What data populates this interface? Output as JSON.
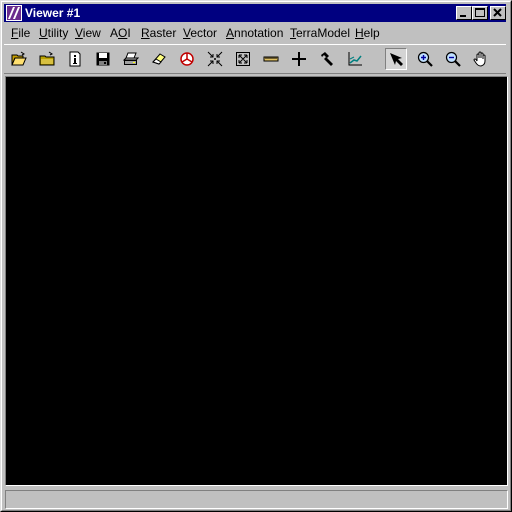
{
  "window": {
    "title": "Viewer #1"
  },
  "titlebar_buttons": [
    {
      "name": "minimize-button",
      "icon": "minimize-icon"
    },
    {
      "name": "maximize-button",
      "icon": "maximize-icon"
    },
    {
      "name": "close-button",
      "icon": "close-icon"
    }
  ],
  "menu": {
    "items": [
      {
        "name": "menu-file",
        "pre": "",
        "ul": "F",
        "post": "ile"
      },
      {
        "name": "menu-utility",
        "pre": "",
        "ul": "U",
        "post": "tility"
      },
      {
        "name": "menu-view",
        "pre": "",
        "ul": "V",
        "post": "iew"
      },
      {
        "name": "menu-aoi",
        "pre": "A",
        "ul": "O",
        "post": "I"
      },
      {
        "name": "menu-raster",
        "pre": "",
        "ul": "R",
        "post": "aster"
      },
      {
        "name": "menu-vector",
        "pre": "",
        "ul": "V",
        "post": "ector"
      },
      {
        "name": "menu-annotation",
        "pre": "",
        "ul": "A",
        "post": "nnotation"
      },
      {
        "name": "menu-terramodel",
        "pre": "",
        "ul": "T",
        "post": "erraModel"
      },
      {
        "name": "menu-help",
        "pre": "",
        "ul": "H",
        "post": "elp"
      }
    ]
  },
  "toolbar": {
    "tools": [
      {
        "name": "open-layer-button",
        "icon": "folder-open-icon"
      },
      {
        "name": "close-layer-button",
        "icon": "folder-close-icon"
      },
      {
        "name": "layer-info-button",
        "icon": "info-icon"
      },
      {
        "name": "save-button",
        "icon": "floppy-icon"
      },
      {
        "name": "print-button",
        "icon": "printer-icon"
      },
      {
        "name": "clear-view-button",
        "icon": "eraser-icon"
      },
      {
        "name": "roam-button",
        "icon": "roam-icon"
      },
      {
        "name": "fit-to-frame-button",
        "icon": "shrink-arrows-icon"
      },
      {
        "name": "reset-zoom-button",
        "icon": "expand-arrows-icon"
      },
      {
        "name": "measure-button",
        "icon": "ruler-icon"
      },
      {
        "name": "inquire-cursor-button",
        "icon": "crosshair-icon"
      },
      {
        "name": "tools-button",
        "icon": "hammer-icon"
      },
      {
        "name": "profile-button",
        "icon": "profile-chart-icon"
      },
      {
        "name": "select-pointer-button",
        "icon": "arrow-pointer-icon",
        "pressed": true
      },
      {
        "name": "zoom-in-button",
        "icon": "zoom-in-icon"
      },
      {
        "name": "zoom-out-button",
        "icon": "zoom-out-icon"
      },
      {
        "name": "pan-button",
        "icon": "hand-icon"
      }
    ]
  },
  "status": {
    "text": ""
  },
  "colors": {
    "titlebar": "#000080",
    "viewport": "#000000",
    "face": "#c0c0c0"
  }
}
